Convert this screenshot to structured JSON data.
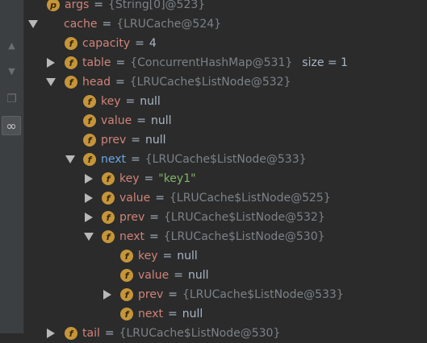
{
  "gutter": {
    "buttons": [
      {
        "name": "up-arrow-icon",
        "glyph": "▲"
      },
      {
        "name": "down-arrow-icon",
        "glyph": "▼"
      },
      {
        "name": "copy-icon",
        "glyph": "❐"
      },
      {
        "name": "watch-icon",
        "glyph": "∞"
      }
    ]
  },
  "rows": [
    {
      "id": "args",
      "arrow": "none",
      "icon": "p",
      "name": "args",
      "eq": "=",
      "value": "{String[0]@523}",
      "vtype": "ref",
      "extra": ""
    },
    {
      "id": "cache",
      "arrow": "down",
      "icon": "obj",
      "name": "cache",
      "eq": "=",
      "value": "{LRUCache@524}",
      "vtype": "ref",
      "extra": ""
    },
    {
      "id": "capacity",
      "arrow": "none",
      "icon": "f",
      "name": "capacity",
      "eq": "=",
      "value": "4",
      "vtype": "val",
      "extra": ""
    },
    {
      "id": "table",
      "arrow": "right",
      "icon": "f",
      "name": "table",
      "eq": "=",
      "value": "{ConcurrentHashMap@531}",
      "vtype": "ref",
      "extra": "size = 1"
    },
    {
      "id": "head",
      "arrow": "down",
      "icon": "f",
      "name": "head",
      "eq": "=",
      "value": "{LRUCache$ListNode@532}",
      "vtype": "ref",
      "extra": ""
    },
    {
      "id": "head-key",
      "arrow": "none",
      "icon": "f",
      "name": "key",
      "eq": "=",
      "value": "null",
      "vtype": "val",
      "extra": ""
    },
    {
      "id": "head-value",
      "arrow": "none",
      "icon": "f",
      "name": "value",
      "eq": "=",
      "value": "null",
      "vtype": "val",
      "extra": ""
    },
    {
      "id": "head-prev",
      "arrow": "none",
      "icon": "f",
      "name": "prev",
      "eq": "=",
      "value": "null",
      "vtype": "val",
      "extra": ""
    },
    {
      "id": "head-next",
      "arrow": "down",
      "icon": "f",
      "name": "next",
      "eq": "=",
      "value": "{LRUCache$ListNode@533}",
      "vtype": "ref",
      "extra": "",
      "selected": true
    },
    {
      "id": "n533-key",
      "arrow": "right",
      "icon": "f",
      "name": "key",
      "eq": "=",
      "value": "\"key1\"",
      "vtype": "str",
      "extra": ""
    },
    {
      "id": "n533-value",
      "arrow": "right",
      "icon": "f",
      "name": "value",
      "eq": "=",
      "value": "{LRUCache$ListNode@525}",
      "vtype": "ref",
      "extra": ""
    },
    {
      "id": "n533-prev",
      "arrow": "right",
      "icon": "f",
      "name": "prev",
      "eq": "=",
      "value": "{LRUCache$ListNode@532}",
      "vtype": "ref",
      "extra": ""
    },
    {
      "id": "n533-next",
      "arrow": "down",
      "icon": "f",
      "name": "next",
      "eq": "=",
      "value": "{LRUCache$ListNode@530}",
      "vtype": "ref",
      "extra": ""
    },
    {
      "id": "n530-key",
      "arrow": "none",
      "icon": "f",
      "name": "key",
      "eq": "=",
      "value": "null",
      "vtype": "val",
      "extra": ""
    },
    {
      "id": "n530-value",
      "arrow": "none",
      "icon": "f",
      "name": "value",
      "eq": "=",
      "value": "null",
      "vtype": "val",
      "extra": ""
    },
    {
      "id": "n530-prev",
      "arrow": "right",
      "icon": "f",
      "name": "prev",
      "eq": "=",
      "value": "{LRUCache$ListNode@533}",
      "vtype": "ref",
      "extra": ""
    },
    {
      "id": "n530-next",
      "arrow": "none",
      "icon": "f",
      "name": "next",
      "eq": "=",
      "value": "null",
      "vtype": "val",
      "extra": ""
    },
    {
      "id": "tail",
      "arrow": "right",
      "icon": "f",
      "name": "tail",
      "eq": "=",
      "value": "{LRUCache$ListNode@530}",
      "vtype": "ref",
      "extra": ""
    }
  ]
}
